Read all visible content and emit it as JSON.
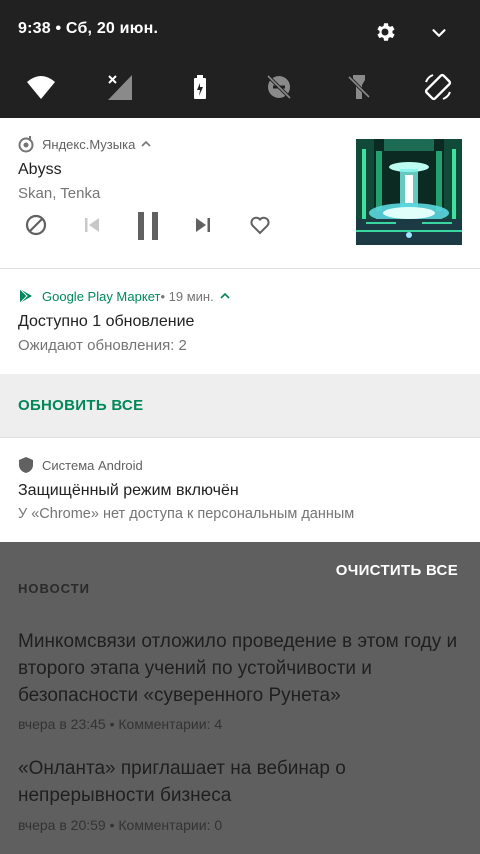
{
  "status": {
    "time_date": "9:38 • Сб, 20 июн."
  },
  "quick_settings": {
    "icons": [
      "wifi-icon",
      "mobile-data-off-icon",
      "battery-saver-icon",
      "dnd-off-icon",
      "flashlight-off-icon",
      "auto-rotate-icon"
    ]
  },
  "notifications": {
    "music": {
      "app": "Яндекс.Музыка",
      "title": "Abyss",
      "artist": "Skan, Tenka"
    },
    "play_market": {
      "app": "Google Play Маркет",
      "time": " • 19 мин.",
      "title": "Доступно 1 обновление",
      "text": "Ожидают обновления: 2",
      "action": "ОБНОВИТЬ ВСЕ"
    },
    "system": {
      "app": "Система Android",
      "title": "Защищённый режим включён",
      "text": "У «Chrome» нет доступа к персональным данным"
    }
  },
  "clear_all": "ОЧИСТИТЬ ВСЕ",
  "news": {
    "section": "НОВОСТИ",
    "items": [
      {
        "title": "Минкомсвязи отложило проведение в этом году и второго этапа учений по устойчивости и безопасности «суверенного Рунета»",
        "meta": "вчера в 23:45 • Комментарии: 4"
      },
      {
        "title": "«Онланта» приглашает на вебинар о непрерывности бизнеса",
        "meta": "вчера в 20:59 • Комментарии: 0"
      }
    ]
  },
  "colors": {
    "accent_green": "#00875a",
    "panel_dark": "#212121",
    "scrim": "#5f5f5f"
  }
}
